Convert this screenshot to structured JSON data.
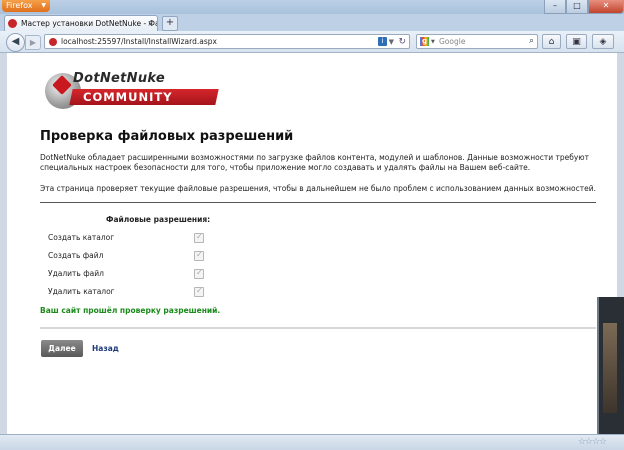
{
  "browser": {
    "app_button": "Firefox",
    "tab_title": "Мастер установки DotNetNuke - Файл…",
    "url": "localhost:25597/Install/InstallWizard.aspx",
    "search_placeholder": "Google"
  },
  "logo": {
    "word": "DotNetNuke",
    "band": "COMMUNITY"
  },
  "page": {
    "title": "Проверка файловых разрешений",
    "paragraph1": "DotNetNuke обладает расширенными возможностями по загрузке файлов контента, модулей и шаблонов. Данные возможности требуют специальных настроек безопасности для того, чтобы приложение могло создавать и удалять файлы на Вашем веб-сайте.",
    "paragraph2": "Эта страница проверяет текущие файловые разрешения, чтобы в дальнейшем не было проблем с использованием данных возможностей.",
    "permissions_title": "Файловые разрешения:",
    "permissions": [
      {
        "label": "Создать каталог",
        "checked": true
      },
      {
        "label": "Создать файл",
        "checked": true
      },
      {
        "label": "Удалить файл",
        "checked": true
      },
      {
        "label": "Удалить каталог",
        "checked": true
      }
    ],
    "success_message": "Ваш сайт прошёл проверку разрешений.",
    "next_button": "Далее",
    "back_link": "Назад"
  },
  "colors": {
    "success": "#1b8a1b",
    "brand_red": "#c9191f",
    "link": "#1f3c7a"
  }
}
